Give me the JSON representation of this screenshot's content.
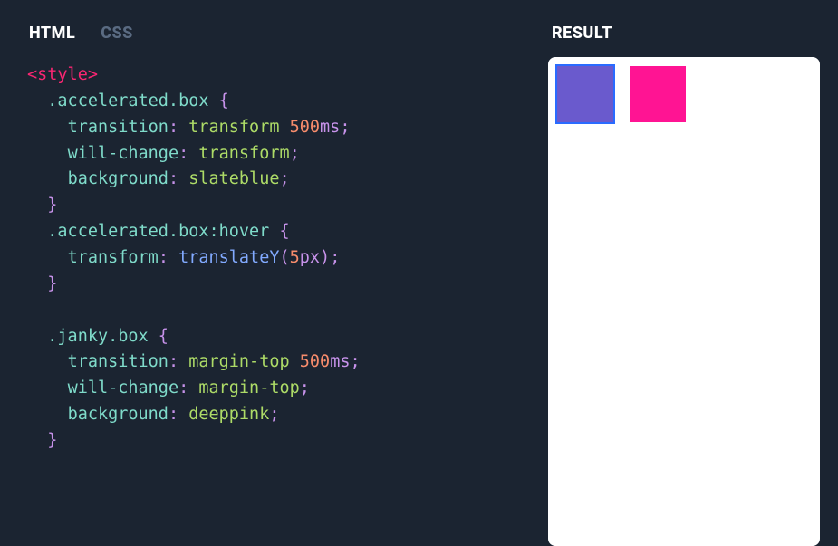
{
  "tabs": {
    "html": "HTML",
    "css": "CSS"
  },
  "result": {
    "label": "RESULT"
  },
  "code": {
    "open_tag": "<style>",
    "sel_accel": ".accelerated.box",
    "sel_accel_hover": ".accelerated.box:hover",
    "sel_janky": ".janky.box",
    "brace_open": " {",
    "brace_close": "}",
    "colon": ":",
    "semi": ";",
    "paren_open": "(",
    "paren_close": ")",
    "prop_transition": "transition",
    "prop_willchange": "will-change",
    "prop_background": "background",
    "prop_transform": "transform",
    "val_transform": " transform",
    "val_500": "500",
    "unit_ms": "ms",
    "val_slateblue": " slateblue",
    "val_margintop": " margin-top",
    "val_deeppink": " deeppink",
    "func_translateY": " translateY",
    "val_5": "5",
    "unit_px": "px",
    "indent1": "  ",
    "indent2": "    "
  },
  "colors": {
    "slateblue": "#6a5acd",
    "deeppink": "#ff1493"
  }
}
